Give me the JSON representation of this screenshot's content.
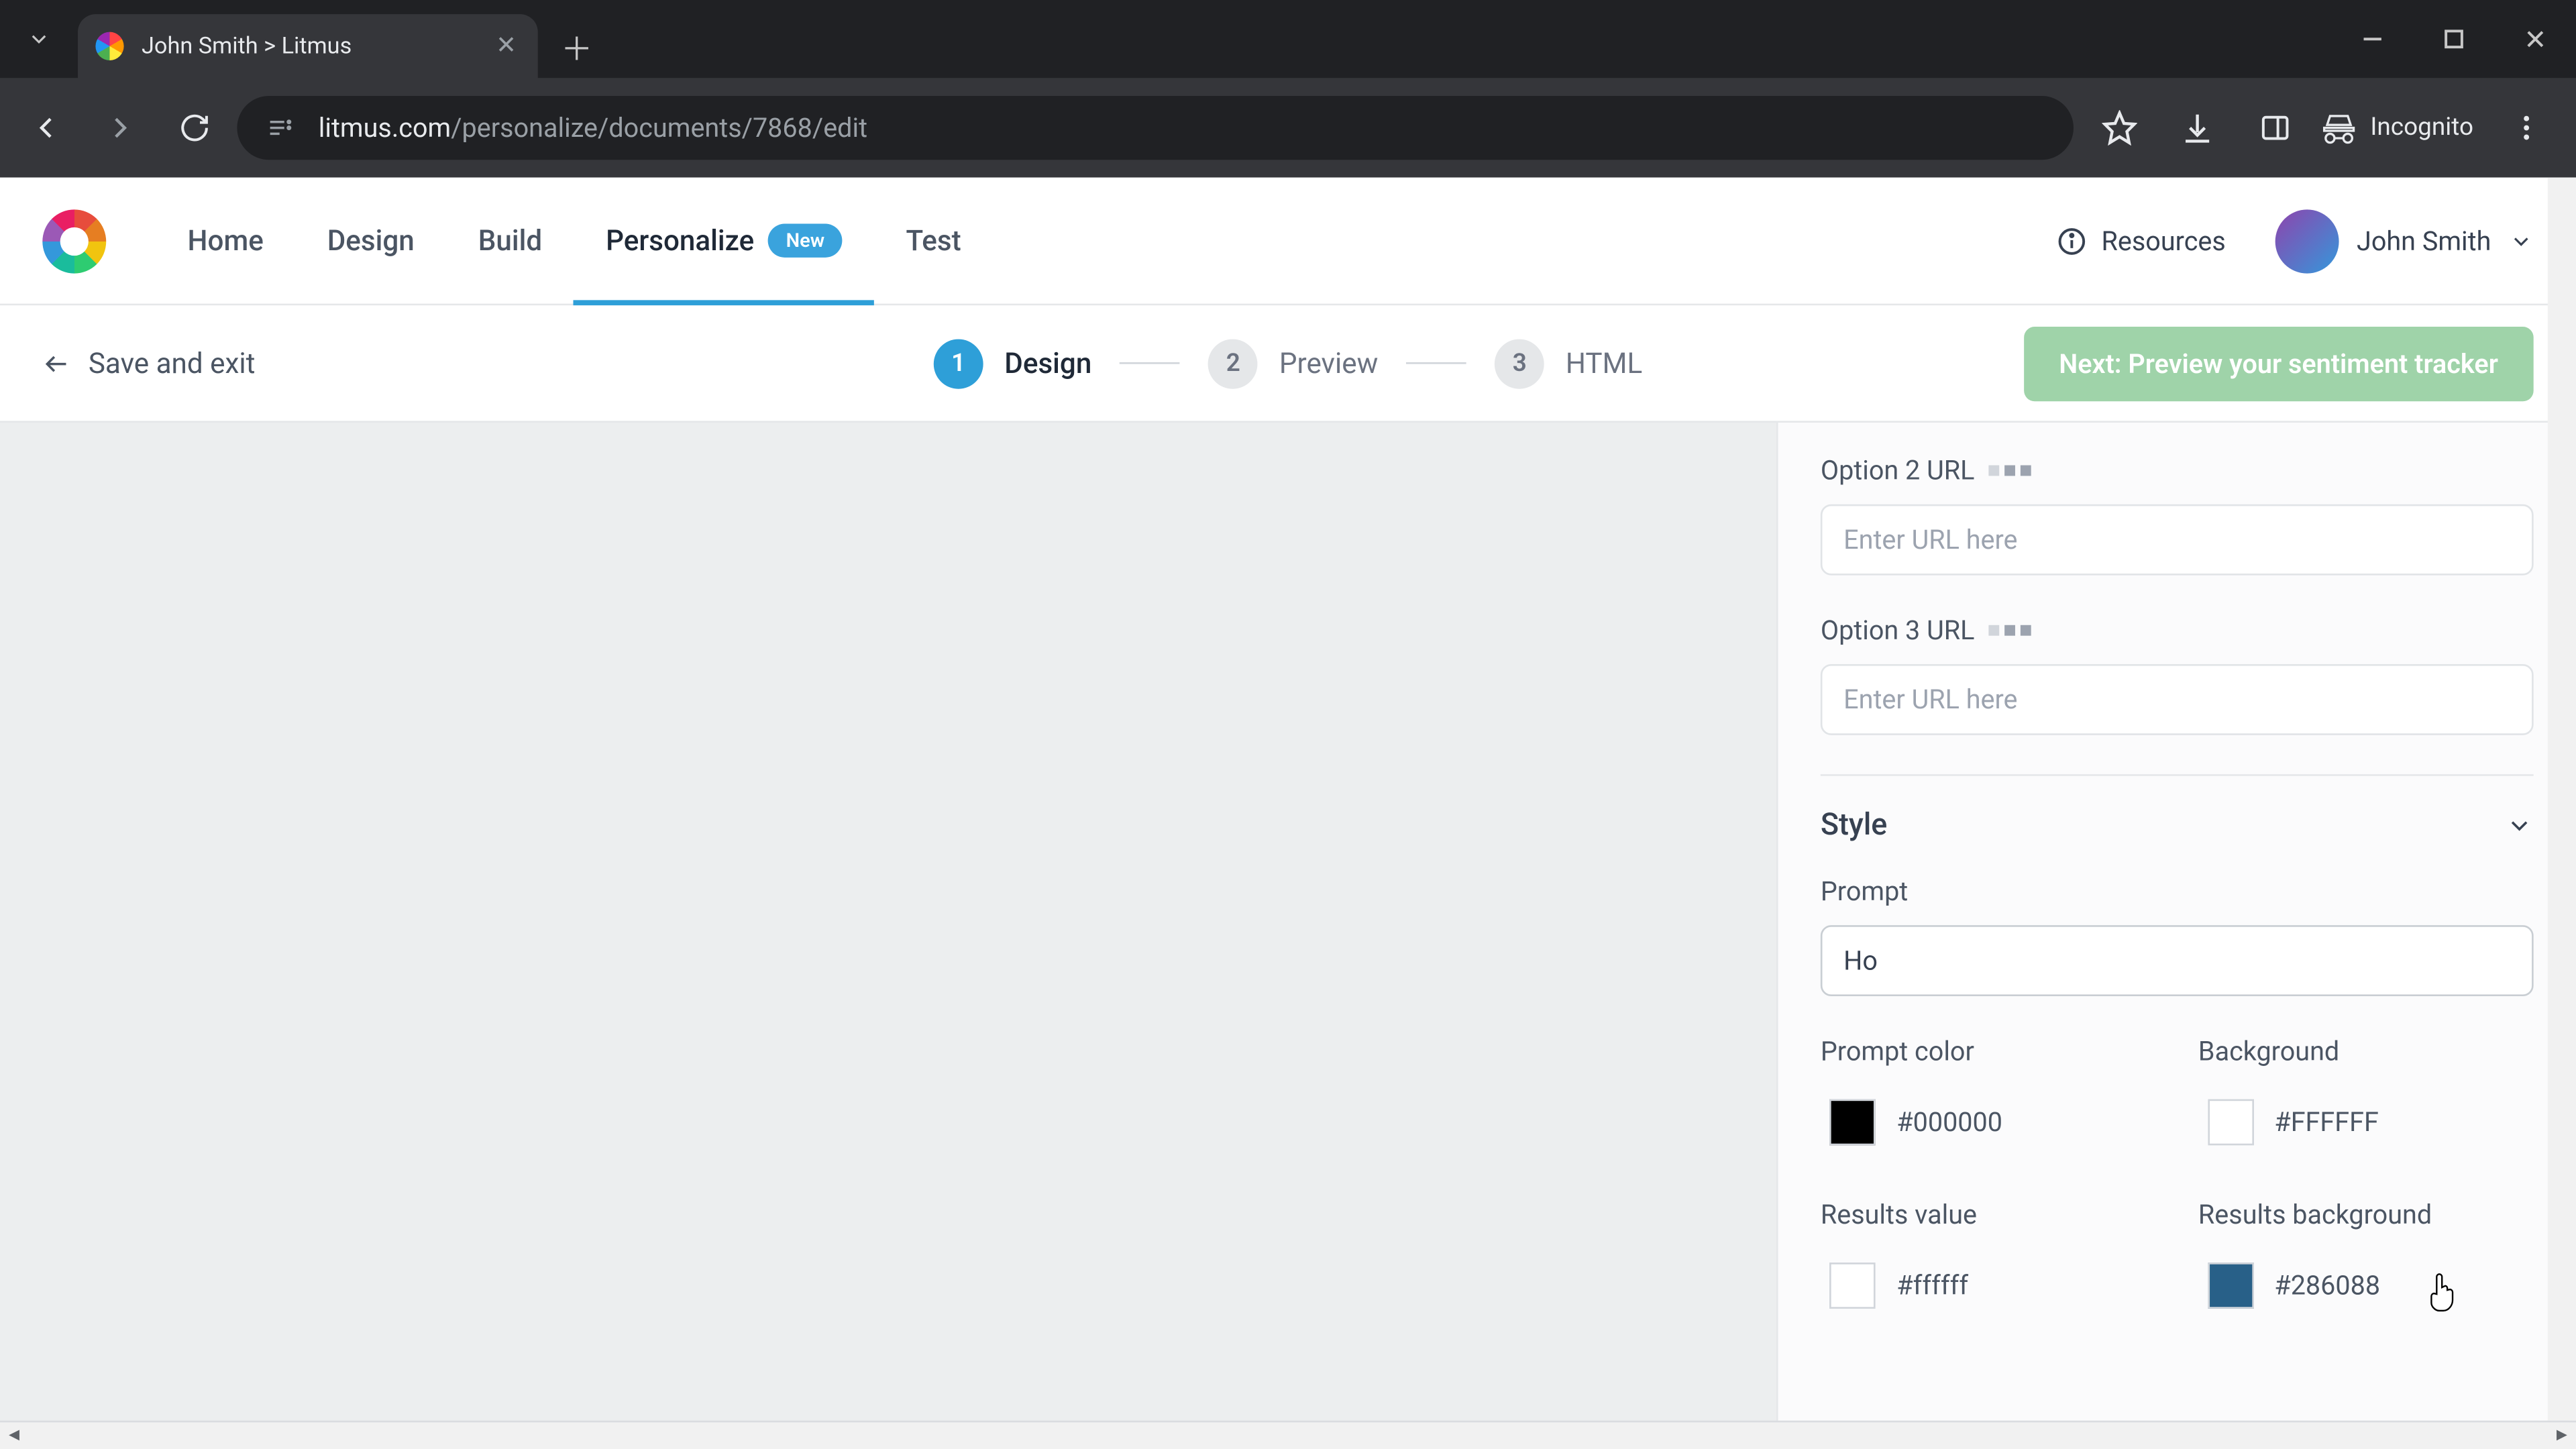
{
  "browser": {
    "tab_title": "John Smith > Litmus",
    "url_display_host": "litmus.com",
    "url_display_path": "/personalize/documents/7868/edit",
    "incognito_label": "Incognito"
  },
  "header": {
    "nav": {
      "home": "Home",
      "design": "Design",
      "build": "Build",
      "personalize": "Personalize",
      "personalize_badge": "New",
      "test": "Test"
    },
    "resources": "Resources",
    "user_name": "John Smith"
  },
  "subbar": {
    "save_exit": "Save and exit",
    "steps": {
      "s1_num": "1",
      "s1_label": "Design",
      "s2_num": "2",
      "s2_label": "Preview",
      "s3_num": "3",
      "s3_label": "HTML"
    },
    "next_button": "Next: Preview your sentiment tracker"
  },
  "side": {
    "option2": {
      "label": "Option 2 URL",
      "placeholder": "Enter URL here",
      "value": ""
    },
    "option3": {
      "label": "Option 3 URL",
      "placeholder": "Enter URL here",
      "value": ""
    },
    "style_section": "Style",
    "prompt": {
      "label": "Prompt",
      "value": "Ho"
    },
    "prompt_color": {
      "label": "Prompt color",
      "hex": "#000000",
      "swatch": "#000000"
    },
    "background": {
      "label": "Background",
      "hex": "#FFFFFF",
      "swatch": "#FFFFFF"
    },
    "results_value": {
      "label": "Results value",
      "hex": "#ffffff",
      "swatch": "#ffffff"
    },
    "results_background": {
      "label": "Results background",
      "hex": "#286088",
      "swatch": "#286088"
    }
  }
}
